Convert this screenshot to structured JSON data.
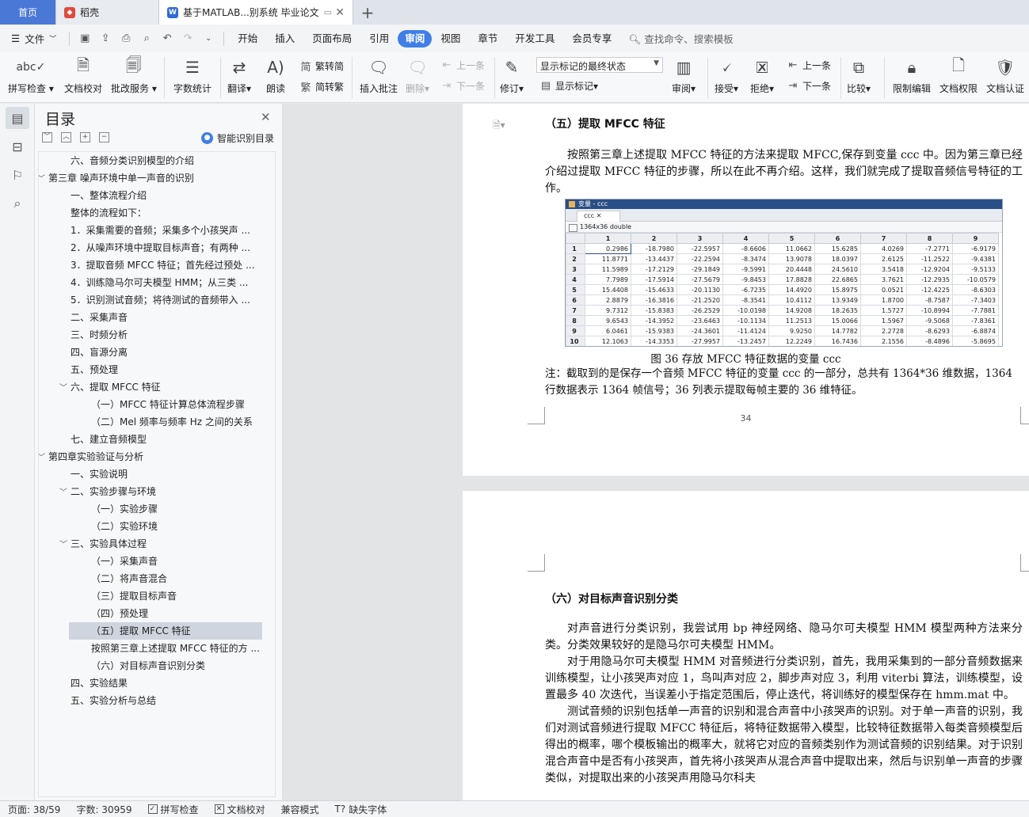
{
  "tabs": {
    "home": "首页",
    "straw": "稻壳",
    "doc": "基于MATLAB...别系统 毕业论文",
    "plus": "+"
  },
  "menu": {
    "file": "文件",
    "items": [
      "开始",
      "插入",
      "页面布局",
      "引用",
      "审阅",
      "视图",
      "章节",
      "开发工具",
      "会员专享"
    ],
    "active": "审阅",
    "search": "查找命令、搜索模板"
  },
  "ribbon": {
    "spellcheck": "拼写检查",
    "doc_proof": "文档校对",
    "batch_service": "批改服务",
    "word_count": "字数统计",
    "translate": "翻译",
    "read_aloud": "朗读",
    "trad": "繁转简",
    "simp": "简转繁",
    "insert_comment": "插入批注",
    "delete": "删除",
    "prev1": "上一条",
    "next1": "下一条",
    "revise": "修订",
    "markup_select": "显示标记的最终状态",
    "show_markup": "显示标记",
    "review": "审阅",
    "accept": "接受",
    "reject": "拒绝",
    "prev2": "上一条",
    "next2": "下一条",
    "compare": "比较",
    "restrict": "限制编辑",
    "doc_perm": "文档权限",
    "doc_cert": "文档认证"
  },
  "toc": {
    "title": "目录",
    "smart": "智能识别目录",
    "items": [
      {
        "text": "六、音频分类识别模型的介绍",
        "level": 2,
        "arrow": ""
      },
      {
        "text": "第三章 噪声环境中单一声音的识别",
        "level": 1,
        "arrow": "﹀"
      },
      {
        "text": "一、整体流程介绍",
        "level": 2,
        "arrow": ""
      },
      {
        "text": "整体的流程如下：",
        "level": 2,
        "arrow": ""
      },
      {
        "text": "1．采集需要的音频；采集多个小孩哭声 ...",
        "level": 2,
        "arrow": ""
      },
      {
        "text": "2．从噪声环境中提取目标声音；有两种 ...",
        "level": 2,
        "arrow": ""
      },
      {
        "text": "3．提取音频 MFCC 特征；首先经过预处 ...",
        "level": 2,
        "arrow": ""
      },
      {
        "text": "4．训练隐马尔可夫模型 HMM；从三类 ...",
        "level": 2,
        "arrow": ""
      },
      {
        "text": "5．识别测试音频；将待测试的音频带入 ...",
        "level": 2,
        "arrow": ""
      },
      {
        "text": "二、采集声音",
        "level": 2,
        "arrow": ""
      },
      {
        "text": "三、时频分析",
        "level": 2,
        "arrow": ""
      },
      {
        "text": "四、盲源分离",
        "level": 2,
        "arrow": ""
      },
      {
        "text": "五、预处理",
        "level": 2,
        "arrow": ""
      },
      {
        "text": "六、提取 MFCC 特征",
        "level": 2,
        "arrow": "﹀"
      },
      {
        "text": "（一）MFCC 特征计算总体流程步骤",
        "level": 3,
        "arrow": ""
      },
      {
        "text": "（二）Mel 频率与频率 Hz 之间的关系",
        "level": 3,
        "arrow": ""
      },
      {
        "text": "七、建立音频模型",
        "level": 2,
        "arrow": ""
      },
      {
        "text": "第四章实验验证与分析",
        "level": 1,
        "arrow": "﹀"
      },
      {
        "text": "一、实验说明",
        "level": 2,
        "arrow": ""
      },
      {
        "text": "二、实验步骤与环境",
        "level": 2,
        "arrow": "﹀"
      },
      {
        "text": "（一）实验步骤",
        "level": 3,
        "arrow": ""
      },
      {
        "text": "（二）实验环境",
        "level": 3,
        "arrow": ""
      },
      {
        "text": "三、实验具体过程",
        "level": 2,
        "arrow": "﹀"
      },
      {
        "text": "（一）采集声音",
        "level": 3,
        "arrow": ""
      },
      {
        "text": "（二）将声音混合",
        "level": 3,
        "arrow": ""
      },
      {
        "text": "（三）提取目标声音",
        "level": 3,
        "arrow": ""
      },
      {
        "text": "（四）预处理",
        "level": 3,
        "arrow": ""
      },
      {
        "text": "（五）提取 MFCC 特征",
        "level": 3,
        "arrow": "",
        "selected": true
      },
      {
        "text": "按照第三章上述提取 MFCC 特征的方 ...",
        "level": 3,
        "arrow": ""
      },
      {
        "text": "（六）对目标声音识别分类",
        "level": 3,
        "arrow": ""
      },
      {
        "text": "四、实验结果",
        "level": 2,
        "arrow": ""
      },
      {
        "text": "五、实验分析与总结",
        "level": 2,
        "arrow": ""
      }
    ]
  },
  "page1": {
    "heading": "（五）提取 MFCC 特征",
    "para": "按照第三章上述提取 MFCC 特征的方法来提取 MFCC,保存到变量 ccc 中。因为第三章已经介绍过提取 MFCC 特征的步骤，所以在此不再介绍。这样，我们就完成了提取音频信号特征的工作。",
    "caption": "图 36 存放 MFCC 特征数据的变量 ccc",
    "note": "注：截取到的是保存一个音频 MFCC 特征的变量 ccc 的一部分，总共有 1364*36 维数据，1364 行数据表示 1364 帧信号；36 列表示提取每帧主要的 36 维特征。",
    "pagenum": "34"
  },
  "varview": {
    "title": "变量 - ccc",
    "tab": "ccc",
    "size": "1364x36 double",
    "cols": [
      "1",
      "2",
      "3",
      "4",
      "5",
      "6",
      "7",
      "8",
      "9"
    ],
    "rows": [
      [
        "1",
        "0.2986",
        "-18.7980",
        "-22.5957",
        "-8.6606",
        "11.0662",
        "15.6285",
        "4.0269",
        "-7.2771",
        "-6.9179"
      ],
      [
        "2",
        "11.8771",
        "-13.4437",
        "-22.2594",
        "-8.3474",
        "13.9078",
        "18.0397",
        "2.6125",
        "-11.2522",
        "-9.4381"
      ],
      [
        "3",
        "11.5989",
        "-17.2129",
        "-29.1849",
        "-9.5991",
        "20.4448",
        "24.5610",
        "3.5418",
        "-12.9204",
        "-9.5133"
      ],
      [
        "4",
        "7.7989",
        "-17.5914",
        "-27.5679",
        "-9.8453",
        "17.8828",
        "22.6865",
        "3.7621",
        "-12.2935",
        "-10.0579"
      ],
      [
        "5",
        "15.4408",
        "-15.4633",
        "-20.1130",
        "-6.7235",
        "14.4920",
        "15.8975",
        "0.0521",
        "-12.4225",
        "-8.6303"
      ],
      [
        "6",
        "2.8879",
        "-16.3816",
        "-21.2520",
        "-8.3541",
        "10.4112",
        "13.9349",
        "1.8700",
        "-8.7587",
        "-7.3403"
      ],
      [
        "7",
        "9.7312",
        "-15.8383",
        "-26.2529",
        "-10.0198",
        "14.9208",
        "18.2635",
        "1.5727",
        "-10.8994",
        "-7.7881"
      ],
      [
        "8",
        "9.6543",
        "-14.3952",
        "-23.6463",
        "-10.1134",
        "11.2513",
        "15.0066",
        "1.5967",
        "-9.5068",
        "-7.8361"
      ],
      [
        "9",
        "6.0461",
        "-15.9383",
        "-24.3601",
        "-11.4124",
        "9.9250",
        "14.7782",
        "2.2728",
        "-8.6293",
        "-6.8874"
      ],
      [
        "10",
        "12.1063",
        "-14.3353",
        "-27.9957",
        "-13.2457",
        "12.2249",
        "16.7436",
        "2.1556",
        "-8.4896",
        "-5.8695"
      ]
    ]
  },
  "page2": {
    "heading": "（六）对目标声音识别分类",
    "para1": "对声音进行分类识别，我尝试用 bp 神经网络、隐马尔可夫模型 HMM 模型两种方法来分类。分类效果较好的是隐马尔可夫模型 HMM。",
    "para2": "对于用隐马尔可夫模型 HMM 对音频进行分类识别，首先，我用采集到的一部分音频数据来训练模型，让小孩哭声对应 1，鸟叫声对应 2，脚步声对应 3，利用 viterbi 算法，训练模型，设置最多 40 次迭代，当误差小于指定范围后，停止迭代，将训练好的模型保存在 hmm.mat 中。",
    "para3": "测试音频的识别包括单一声音的识别和混合声音中小孩哭声的识别。对于单一声音的识别，我们对测试音频进行提取 MFCC 特征后，将特征数据带入模型，比较特征数据带入每类音频模型后得出的概率，哪个模板输出的概率大，就将它对应的音频类别作为测试音频的识别结果。对于识别混合声音中是否有小孩哭声，首先将小孩哭声从混合声音中提取出来，然后与识别单一声音的步骤类似，对提取出来的小孩哭声用隐马尔科夫"
  },
  "status": {
    "page": "页面: 38/59",
    "words": "字数: 30959",
    "spell": "拼写检查",
    "proof": "文档校对",
    "compat": "兼容模式",
    "missing_font": "缺失字体"
  }
}
